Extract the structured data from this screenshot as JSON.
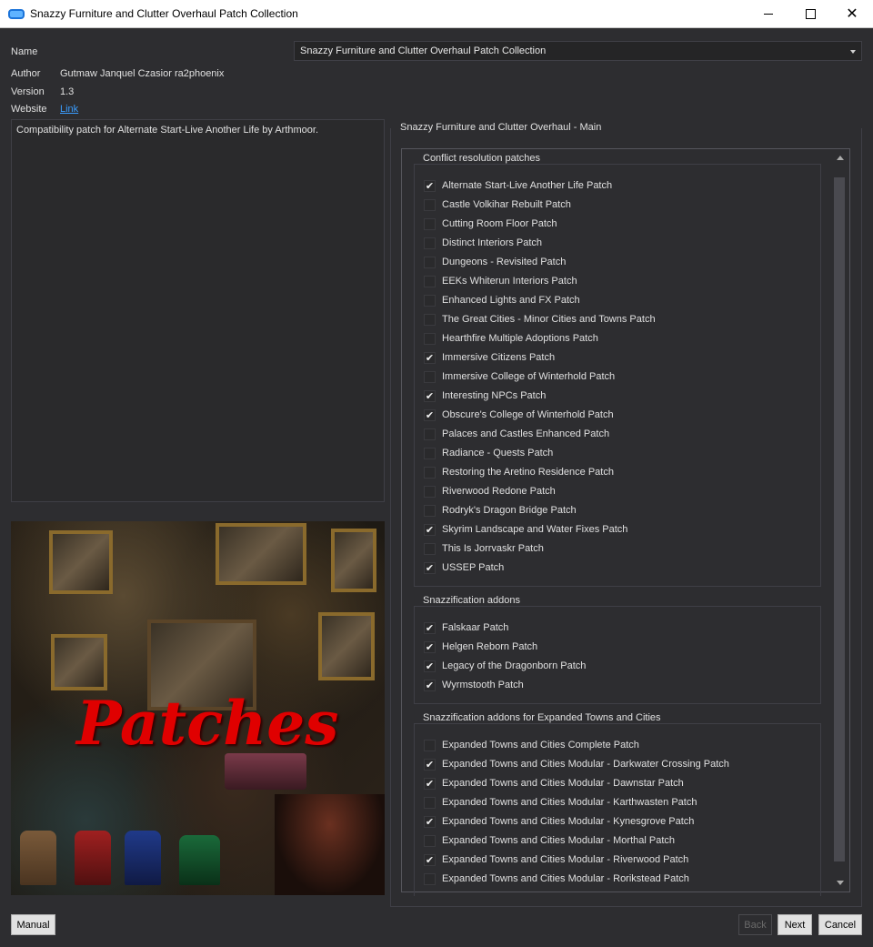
{
  "window": {
    "title": "Snazzy Furniture and Clutter Overhaul Patch Collection"
  },
  "info": {
    "name_label": "Name",
    "name_value": "Snazzy Furniture and Clutter Overhaul Patch Collection",
    "author_label": "Author",
    "author_value": "Gutmaw Janquel Czasior ra2phoenix",
    "version_label": "Version",
    "version_value": "1.3",
    "website_label": "Website",
    "website_link": "Link"
  },
  "description": "Compatibility patch for Alternate Start-Live Another Life by Arthmoor.",
  "image": {
    "overlay_text": "Patches"
  },
  "page": {
    "title": "Snazzy Furniture and Clutter Overhaul - Main"
  },
  "groups": [
    {
      "title": "Conflict resolution patches",
      "options": [
        {
          "label": "Alternate Start-Live Another Life Patch",
          "checked": true
        },
        {
          "label": "Castle Volkihar Rebuilt Patch",
          "checked": false
        },
        {
          "label": "Cutting Room Floor Patch",
          "checked": false
        },
        {
          "label": "Distinct Interiors Patch",
          "checked": false
        },
        {
          "label": "Dungeons - Revisited Patch",
          "checked": false
        },
        {
          "label": "EEKs Whiterun Interiors Patch",
          "checked": false
        },
        {
          "label": "Enhanced Lights and FX Patch",
          "checked": false
        },
        {
          "label": "The Great Cities - Minor Cities and Towns Patch",
          "checked": false
        },
        {
          "label": "Hearthfire Multiple Adoptions Patch",
          "checked": false
        },
        {
          "label": "Immersive Citizens Patch",
          "checked": true
        },
        {
          "label": "Immersive College of Winterhold Patch",
          "checked": false
        },
        {
          "label": "Interesting NPCs Patch",
          "checked": true
        },
        {
          "label": "Obscure's College of Winterhold Patch",
          "checked": true
        },
        {
          "label": "Palaces and Castles Enhanced Patch",
          "checked": false
        },
        {
          "label": "Radiance - Quests Patch",
          "checked": false
        },
        {
          "label": "Restoring the Aretino Residence Patch",
          "checked": false
        },
        {
          "label": "Riverwood Redone Patch",
          "checked": false
        },
        {
          "label": "Rodryk's Dragon Bridge Patch",
          "checked": false
        },
        {
          "label": "Skyrim Landscape and Water Fixes Patch",
          "checked": true
        },
        {
          "label": "This Is Jorrvaskr Patch",
          "checked": false
        },
        {
          "label": "USSEP Patch",
          "checked": true
        }
      ]
    },
    {
      "title": "Snazzification addons",
      "options": [
        {
          "label": "Falskaar Patch",
          "checked": true
        },
        {
          "label": "Helgen Reborn Patch",
          "checked": true
        },
        {
          "label": "Legacy of the Dragonborn Patch",
          "checked": true
        },
        {
          "label": "Wyrmstooth Patch",
          "checked": true
        }
      ]
    },
    {
      "title": "Snazzification addons for Expanded Towns and Cities",
      "options": [
        {
          "label": "Expanded Towns and Cities Complete Patch",
          "checked": false
        },
        {
          "label": "Expanded Towns and Cities Modular - Darkwater Crossing Patch",
          "checked": true
        },
        {
          "label": "Expanded Towns and Cities Modular - Dawnstar Patch",
          "checked": true
        },
        {
          "label": "Expanded Towns and Cities Modular - Karthwasten Patch",
          "checked": false
        },
        {
          "label": "Expanded Towns and Cities Modular - Kynesgrove Patch",
          "checked": true
        },
        {
          "label": "Expanded Towns and Cities Modular - Morthal Patch",
          "checked": false
        },
        {
          "label": "Expanded Towns and Cities Modular - Riverwood Patch",
          "checked": true
        },
        {
          "label": "Expanded Towns and Cities Modular - Rorikstead Patch",
          "checked": false
        }
      ]
    }
  ],
  "buttons": {
    "manual": "Manual",
    "back": "Back",
    "next": "Next",
    "cancel": "Cancel"
  }
}
